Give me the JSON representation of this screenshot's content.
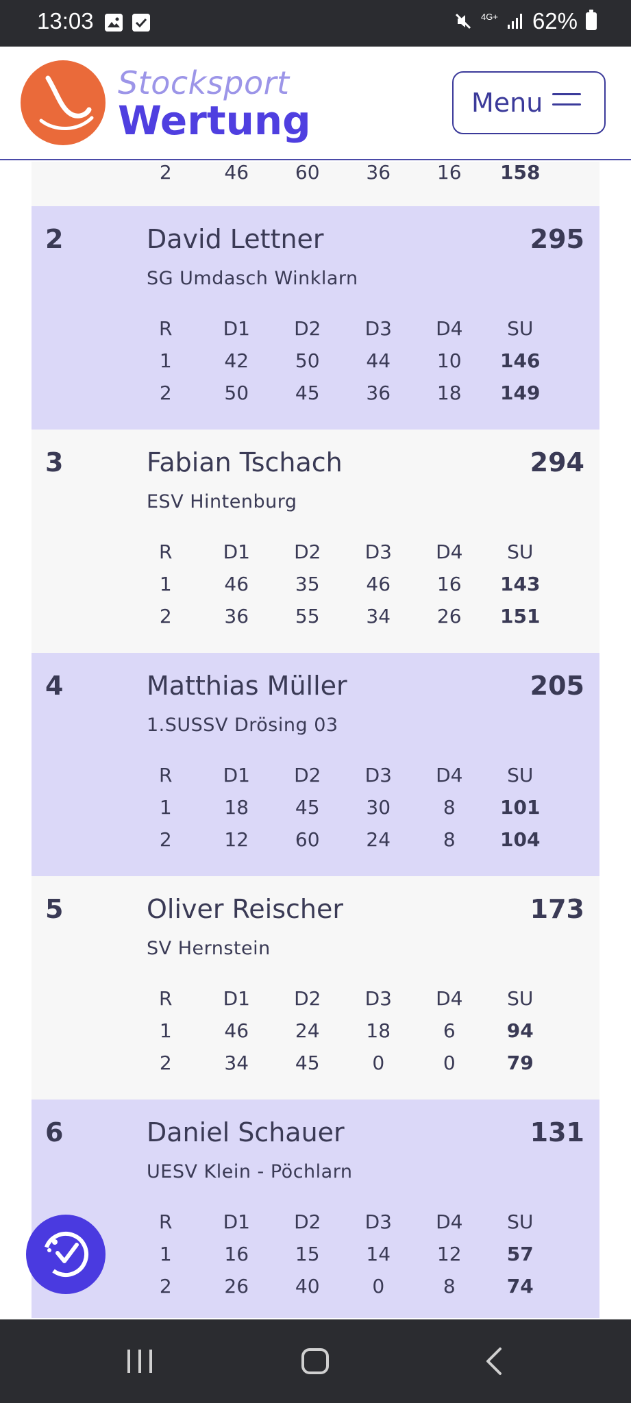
{
  "status_bar": {
    "time": "13:03",
    "network": "4G+",
    "battery": "62%"
  },
  "header": {
    "logo_line1": "Stocksport",
    "logo_line2": "Wertung",
    "menu_label": "Menu"
  },
  "table_headers": [
    "R",
    "D1",
    "D2",
    "D3",
    "D4",
    "SU"
  ],
  "partial_row": [
    "2",
    "46",
    "60",
    "36",
    "16",
    "158"
  ],
  "entries": [
    {
      "rank": "2",
      "name": "David Lettner",
      "total": "295",
      "club": "SG Umdasch Winklarn",
      "rows": [
        [
          "1",
          "42",
          "50",
          "44",
          "10",
          "146"
        ],
        [
          "2",
          "50",
          "45",
          "36",
          "18",
          "149"
        ]
      ]
    },
    {
      "rank": "3",
      "name": "Fabian Tschach",
      "total": "294",
      "club": "ESV Hintenburg",
      "rows": [
        [
          "1",
          "46",
          "35",
          "46",
          "16",
          "143"
        ],
        [
          "2",
          "36",
          "55",
          "34",
          "26",
          "151"
        ]
      ]
    },
    {
      "rank": "4",
      "name": "Matthias Müller",
      "total": "205",
      "club": "1.SUSSV Drösing 03",
      "rows": [
        [
          "1",
          "18",
          "45",
          "30",
          "8",
          "101"
        ],
        [
          "2",
          "12",
          "60",
          "24",
          "8",
          "104"
        ]
      ]
    },
    {
      "rank": "5",
      "name": "Oliver Reischer",
      "total": "173",
      "club": "SV Hernstein",
      "rows": [
        [
          "1",
          "46",
          "24",
          "18",
          "6",
          "94"
        ],
        [
          "2",
          "34",
          "45",
          "0",
          "0",
          "79"
        ]
      ]
    },
    {
      "rank": "6",
      "name": "Daniel Schauer",
      "total": "131",
      "club": "UESV Klein - Pöchlarn",
      "rows": [
        [
          "1",
          "16",
          "15",
          "14",
          "12",
          "57"
        ],
        [
          "2",
          "26",
          "40",
          "0",
          "8",
          "74"
        ]
      ]
    }
  ],
  "icons": {
    "gallery": "image-icon",
    "check": "check-box-icon",
    "mute": "mute-icon",
    "signal": "signal-icon",
    "battery": "battery-icon",
    "menu": "hamburger-icon",
    "accessibility": "accessibility-icon",
    "recent": "recent-apps-icon",
    "home": "home-icon",
    "back": "back-icon"
  },
  "colors": {
    "brand_orange": "#ea6a3a",
    "brand_purple": "#4f3fe0",
    "row_highlight": "#dbd8f8"
  }
}
